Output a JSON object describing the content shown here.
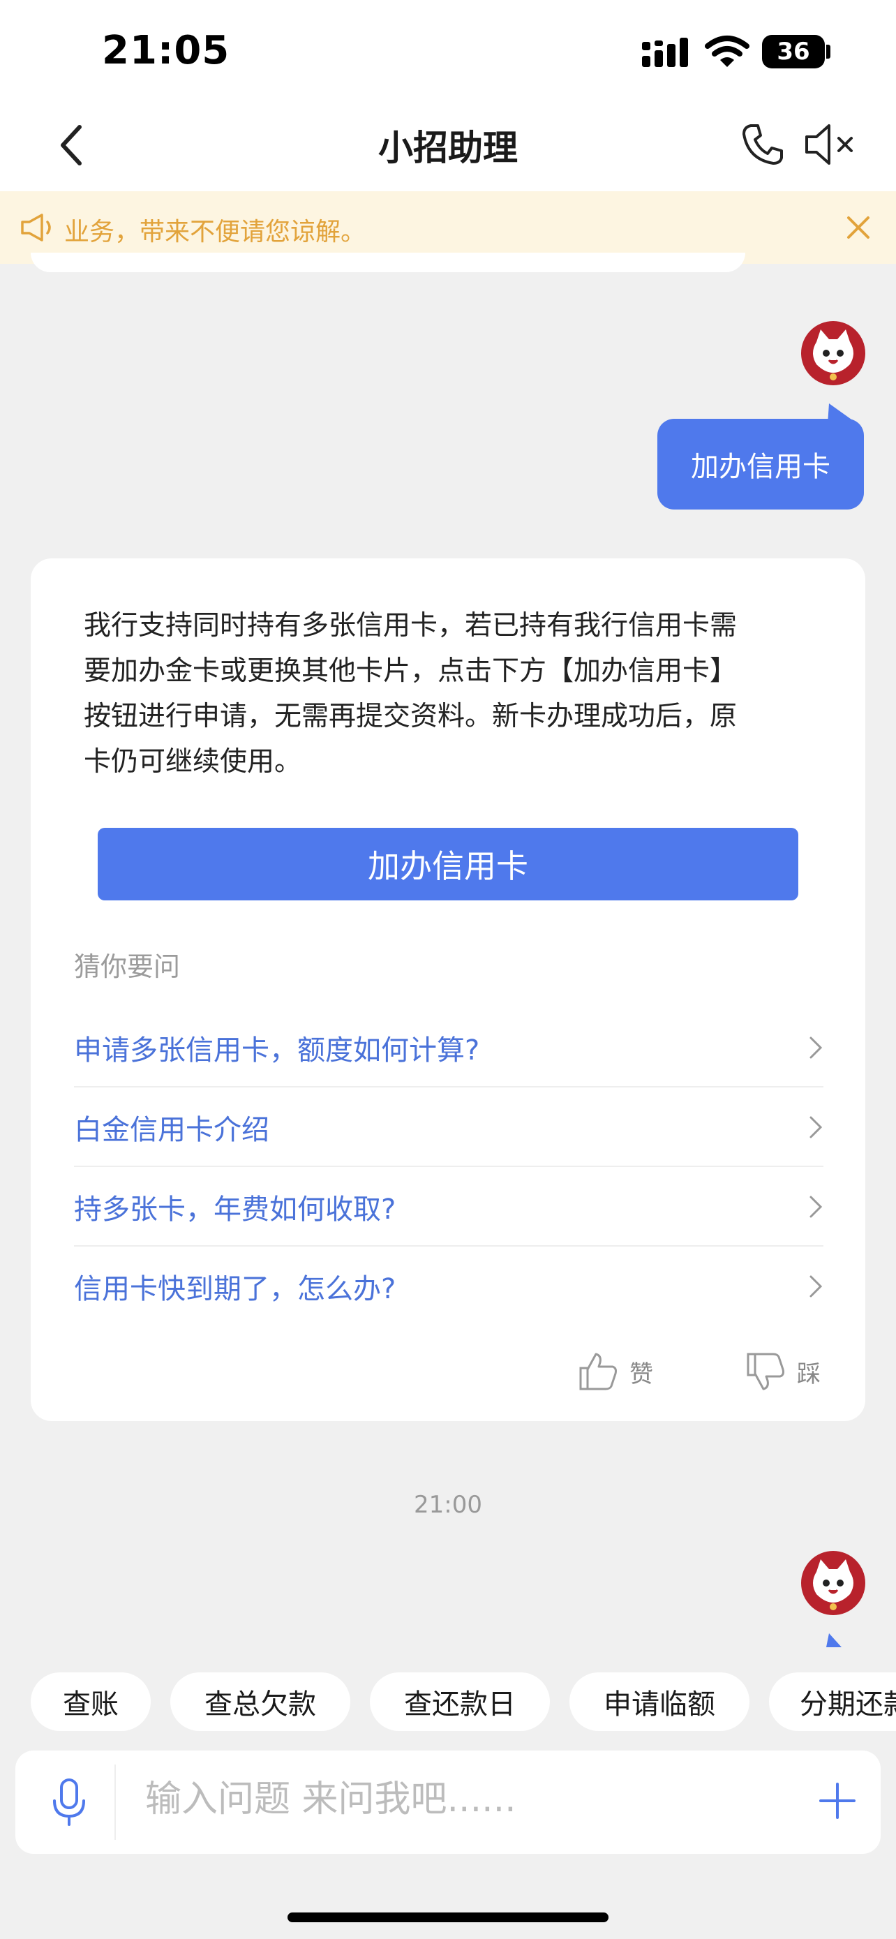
{
  "status_bar": {
    "time": "21:05",
    "battery": "36"
  },
  "header": {
    "title": "小招助理"
  },
  "notice": {
    "text": "业务，带来不便请您谅解。"
  },
  "chat": {
    "user_message": "加办信用卡",
    "answer_lines": [
      "我行支持同时持有多张信用卡，若已持有我行信用卡需",
      "要加办金卡或更换其他卡片，点击下方【加办信用卡】",
      "按钮进行申请，无需再提交资料。新卡办理成功后，原",
      "卡仍可继续使用。"
    ],
    "action_button": "加办信用卡",
    "guess_title": "猜你要问",
    "faq": [
      "申请多张信用卡，额度如何计算?",
      "白金信用卡介绍",
      "持多张卡，年费如何收取?",
      "信用卡快到期了，怎么办?"
    ],
    "like_label": "赞",
    "dislike_label": "踩",
    "timestamp": "21:00"
  },
  "quick_replies": [
    "查账",
    "查总欠款",
    "查还款日",
    "申请临额",
    "分期还款"
  ],
  "input": {
    "placeholder": "输入问题 来问我吧......"
  },
  "colors": {
    "accent": "#4f79ec",
    "link": "#4a72d9",
    "notice_text": "#e2a33b",
    "notice_bg": "#fdf5e1",
    "avatar_bg": "#b8222c"
  }
}
